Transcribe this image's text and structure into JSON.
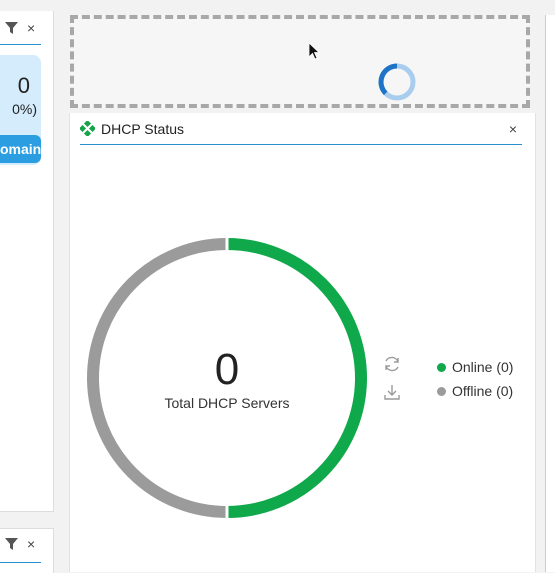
{
  "left_panel": {
    "close_label": "×",
    "stat_value": "0",
    "stat_percent": "0%)",
    "button_label": "omain"
  },
  "left_panel2": {
    "close_label": "×"
  },
  "widget": {
    "title": "DHCP Status",
    "close_label": "×"
  },
  "chart_data": {
    "type": "pie",
    "center_value": "0",
    "center_label": "Total DHCP Servers",
    "categories": [
      "Online",
      "Offline"
    ],
    "values": [
      0,
      0
    ],
    "visual_split": [
      0.5,
      0.5
    ],
    "colors": {
      "Online": "#0fa84a",
      "Offline": "#9b9b9b"
    },
    "legend": [
      {
        "label": "Online (0)",
        "color": "#0fa84a"
      },
      {
        "label": "Offline (0)",
        "color": "#9b9b9b"
      }
    ],
    "legend_position": "right"
  }
}
